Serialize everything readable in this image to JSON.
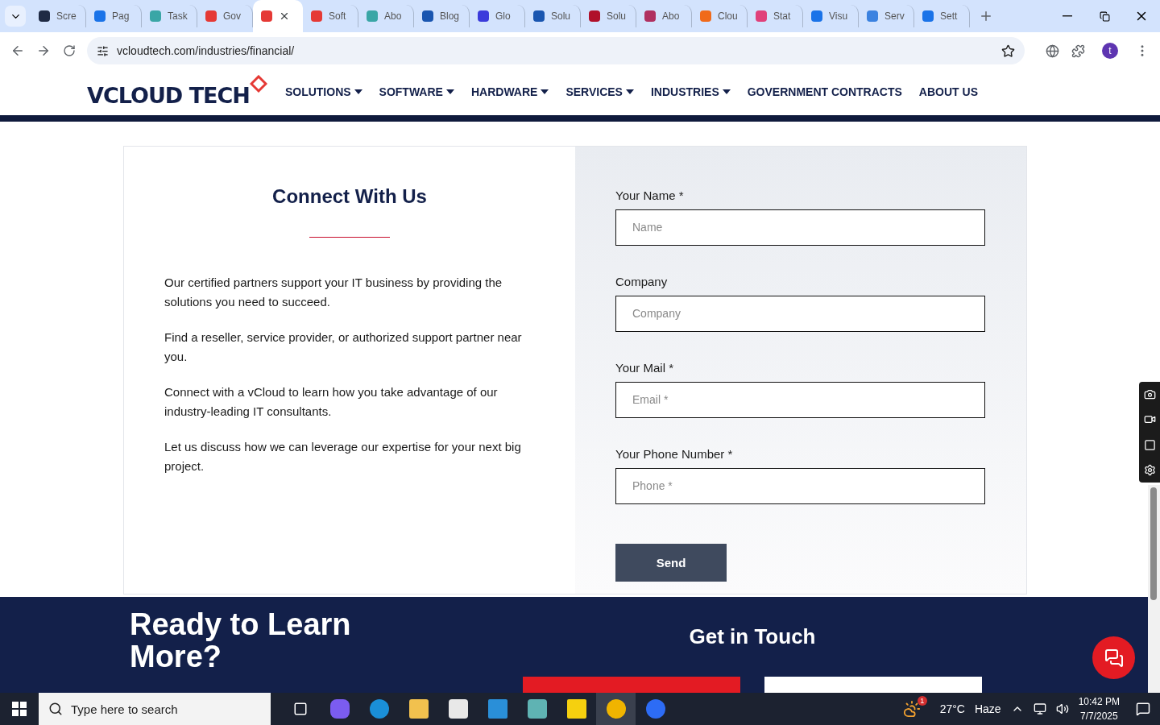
{
  "browser": {
    "tabs": [
      {
        "title": "Scre",
        "selected": false,
        "color": "#1f2a44"
      },
      {
        "title": "Pag",
        "selected": false,
        "color": "#1a73e8"
      },
      {
        "title": "Task",
        "selected": false,
        "color": "#3aa6a6"
      },
      {
        "title": "Gov",
        "selected": false,
        "color": "#e53935"
      },
      {
        "selected": true,
        "color": "#e53935"
      },
      {
        "title": "Soft",
        "selected": false,
        "color": "#e53935"
      },
      {
        "title": "Abo",
        "selected": false,
        "color": "#3aa6a6"
      },
      {
        "title": "Blog",
        "selected": false,
        "color": "#1a56b0"
      },
      {
        "title": "Glo",
        "selected": false,
        "color": "#3b3bdb"
      },
      {
        "title": "Solu",
        "selected": false,
        "color": "#1a56b0"
      },
      {
        "title": "Solu",
        "selected": false,
        "color": "#b0102a"
      },
      {
        "title": "Abo",
        "selected": false,
        "color": "#b03060"
      },
      {
        "title": "Clou",
        "selected": false,
        "color": "#f06a1a"
      },
      {
        "title": "Stat",
        "selected": false,
        "color": "#e0407a"
      },
      {
        "title": "Visu",
        "selected": false,
        "color": "#1a73e8"
      },
      {
        "title": "Serv",
        "selected": false,
        "color": "#3b82e0"
      },
      {
        "title": "Sett",
        "selected": false,
        "color": "#1a73e8"
      }
    ],
    "url": "vcloudtech.com/industries/financial/",
    "profile": "t"
  },
  "site": {
    "logo": "VCLOUD TECH",
    "nav": [
      {
        "label": "SOLUTIONS",
        "dropdown": true
      },
      {
        "label": "SOFTWARE",
        "dropdown": true
      },
      {
        "label": "HARDWARE",
        "dropdown": true
      },
      {
        "label": "SERVICES",
        "dropdown": true
      },
      {
        "label": "INDUSTRIES",
        "dropdown": true
      },
      {
        "label": "GOVERNMENT CONTRACTS",
        "dropdown": false
      },
      {
        "label": "ABOUT US",
        "dropdown": false
      }
    ]
  },
  "contact": {
    "title": "Connect With Us",
    "paragraphs": [
      "Our certified partners support your IT business by providing the solutions you need to succeed.",
      "Find a reseller, service provider, or authorized support partner near you.",
      "Connect with a vCloud to learn how you take advantage of our industry-leading IT consultants.",
      "Let us discuss how we can leverage our expertise for your next big project."
    ],
    "fields": [
      {
        "label": "Your Name *",
        "placeholder": "Name"
      },
      {
        "label": "Company",
        "placeholder": "Company"
      },
      {
        "label": "Your Mail *",
        "placeholder": "Email *"
      },
      {
        "label": "Your Phone Number *",
        "placeholder": "Phone *"
      }
    ],
    "submit": "Send"
  },
  "footer": {
    "heading": "Ready to Learn More?",
    "subheading": "Get in Touch"
  },
  "taskbar": {
    "search_placeholder": "Type here to search",
    "weather": {
      "badge": "1",
      "temperature": "27°C",
      "condition": "Haze"
    },
    "time": "10:42 PM",
    "date": "7/7/2025"
  }
}
